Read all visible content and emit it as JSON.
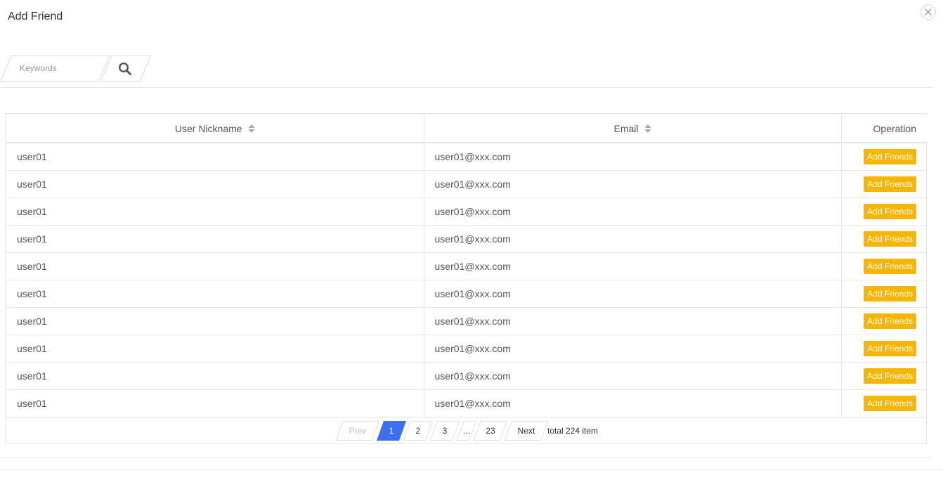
{
  "dialog": {
    "title": "Add Friend",
    "close_icon": "close-icon"
  },
  "search": {
    "placeholder": "Keywords",
    "value": "",
    "button_icon": "search-icon"
  },
  "table": {
    "columns": [
      {
        "label": "User Nickname",
        "sortable": true
      },
      {
        "label": "Email",
        "sortable": true
      },
      {
        "label": "Operation",
        "sortable": false
      }
    ],
    "rows": [
      {
        "nickname": "user01",
        "email": "user01@xxx.com",
        "action": "Add Friends"
      },
      {
        "nickname": "user01",
        "email": "user01@xxx.com",
        "action": "Add Friends"
      },
      {
        "nickname": "user01",
        "email": "user01@xxx.com",
        "action": "Add Friends"
      },
      {
        "nickname": "user01",
        "email": "user01@xxx.com",
        "action": "Add Friends"
      },
      {
        "nickname": "user01",
        "email": "user01@xxx.com",
        "action": "Add Friends"
      },
      {
        "nickname": "user01",
        "email": "user01@xxx.com",
        "action": "Add Friends"
      },
      {
        "nickname": "user01",
        "email": "user01@xxx.com",
        "action": "Add Friends"
      },
      {
        "nickname": "user01",
        "email": "user01@xxx.com",
        "action": "Add Friends"
      },
      {
        "nickname": "user01",
        "email": "user01@xxx.com",
        "action": "Add Friends"
      },
      {
        "nickname": "user01",
        "email": "user01@xxx.com",
        "action": "Add Friends"
      }
    ]
  },
  "pagination": {
    "prev": "Prev",
    "pages": [
      "1",
      "2",
      "3"
    ],
    "ellipsis": "...",
    "last_page": "23",
    "next": "Next",
    "current": "1",
    "total": "total 224 item"
  },
  "colors": {
    "accent_button": "#f7b500",
    "active_page": "#3d6ff2",
    "border": "#e6e6e6"
  }
}
